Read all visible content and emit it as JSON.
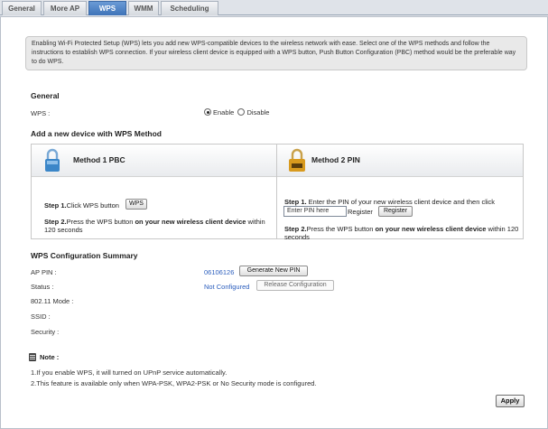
{
  "tabs": [
    {
      "label": "General",
      "active": false
    },
    {
      "label": "More AP",
      "active": false
    },
    {
      "label": "WPS",
      "active": true
    },
    {
      "label": "WMM",
      "active": false
    },
    {
      "label": "Scheduling",
      "active": false
    }
  ],
  "intro_text": "Enabling Wi-Fi Protected Setup (WPS) lets you add new WPS-compatible devices to the wireless network with ease. Select one of the WPS methods and follow the instructions to establish WPS connection. If your wireless client device is equipped with a WPS button, Push Button Configuration (PBC) method would be the preferable way to do WPS.",
  "general": {
    "title": "General",
    "wps_label": "WPS :",
    "enable_label": "Enable",
    "disable_label": "Disable",
    "selected": "Enable"
  },
  "add_device": {
    "title": "Add a new device with WPS Method",
    "method1": {
      "title": "Method 1 PBC",
      "step1_prefix": "Step 1.",
      "step1_text": "Click WPS button",
      "wps_button": "WPS",
      "step2_prefix": "Step 2.",
      "step2_text_a": "Press the WPS button ",
      "step2_bold": "on your new wireless client device",
      "step2_text_b": " within 120 seconds"
    },
    "method2": {
      "title": "Method 2 PIN",
      "step1_prefix": "Step 1.",
      "step1_text": " Enter the PIN of your new wireless client device and then click",
      "pin_placeholder": "Enter PIN here",
      "register_text": "Register",
      "register_button": "Register",
      "step2_prefix": "Step 2.",
      "step2_text_a": "Press the WPS button ",
      "step2_bold": "on your new wireless client device",
      "step2_text_b": " within 120 seconds"
    }
  },
  "summary": {
    "title": "WPS Configuration Summary",
    "ap_pin_label": "AP PIN :",
    "ap_pin_value": "06106126",
    "generate_button": "Generate New PIN",
    "status_label": "Status :",
    "status_value": "Not Configured",
    "release_button": "Release Configuration",
    "mode_label": "802.11 Mode :",
    "ssid_label": "SSID :",
    "security_label": "Security :"
  },
  "note": {
    "title": "Note :",
    "items": [
      "1.If you enable WPS, it will turned on UPnP service automatically.",
      "2.This feature is available only when WPA-PSK, WPA2-PSK or No Security mode is configured."
    ]
  },
  "apply_button": "Apply",
  "colors": {
    "active_tab": "#4a7fc4",
    "link": "#2a5dbd",
    "lock_blue": "#3b86c8",
    "lock_gold": "#d89a1e"
  },
  "icons": {
    "method1": "lock-icon",
    "method2": "pin-lock-icon",
    "note": "note-icon"
  }
}
